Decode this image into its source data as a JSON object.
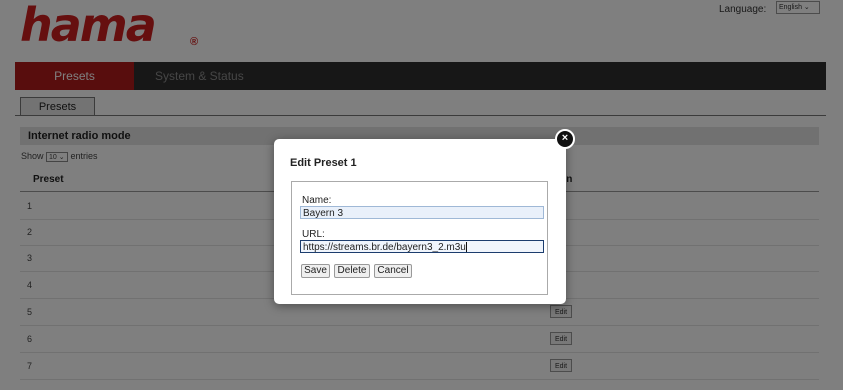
{
  "header": {
    "logo_text": "hama",
    "logo_registered": "®",
    "language_label": "Language:",
    "language_value": "English ⌄"
  },
  "nav": {
    "tabs": [
      {
        "label": "Presets"
      },
      {
        "label": "System & Status"
      }
    ]
  },
  "subtab": {
    "label": "Presets"
  },
  "section": {
    "title": "Internet radio mode",
    "show_prefix": "Show",
    "show_value": "10 ⌄",
    "show_suffix": "entries"
  },
  "table": {
    "columns": [
      "Preset",
      "tion"
    ],
    "rows": [
      {
        "num": "1"
      },
      {
        "num": "2"
      },
      {
        "num": "3"
      },
      {
        "num": "4"
      },
      {
        "num": "5",
        "action": "Edit"
      },
      {
        "num": "6",
        "action": "Edit"
      },
      {
        "num": "7",
        "action": "Edit"
      }
    ]
  },
  "modal": {
    "title": "Edit Preset 1",
    "close_glyph": "×",
    "name_label": "Name:",
    "name_value": "Bayern 3",
    "url_label": "URL:",
    "url_value": "https://streams.br.de/bayern3_2.m3u",
    "save_label": "Save",
    "delete_label": "Delete",
    "cancel_label": "Cancel"
  }
}
